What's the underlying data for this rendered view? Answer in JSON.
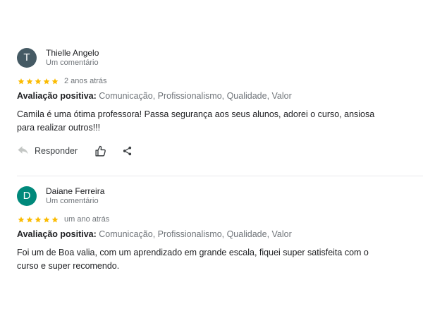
{
  "reviews": [
    {
      "avatar_letter": "T",
      "name": "Thielle Angelo",
      "subcount": "Um comentário",
      "stars": 5,
      "date": "2 anos atrás",
      "rating_label": "Avaliação positiva:",
      "rating_values": "Comunicação, Profissionalismo, Qualidade, Valor",
      "text": "Camila é uma ótima professora! Passa segurança aos seus alunos, adorei o curso, ansiosa para realizar outros!!!",
      "reply_label": "Responder"
    },
    {
      "avatar_letter": "D",
      "name": "Daiane Ferreira",
      "subcount": "Um comentário",
      "stars": 5,
      "date": "um ano atrás",
      "rating_label": "Avaliação positiva:",
      "rating_values": "Comunicação, Profissionalismo, Qualidade, Valor",
      "text": "Foi um de Boa valia,  com um aprendizado em grande escala, fiquei super satisfeita com o curso e super recomendo."
    }
  ],
  "colors": {
    "star": "#fbbc04",
    "avatar_1": "#455a64",
    "avatar_2": "#00897b",
    "muted_text": "#70757a"
  },
  "icons": [
    "star-icon",
    "reply-arrow-icon",
    "thumbs-up-icon",
    "share-icon"
  ]
}
